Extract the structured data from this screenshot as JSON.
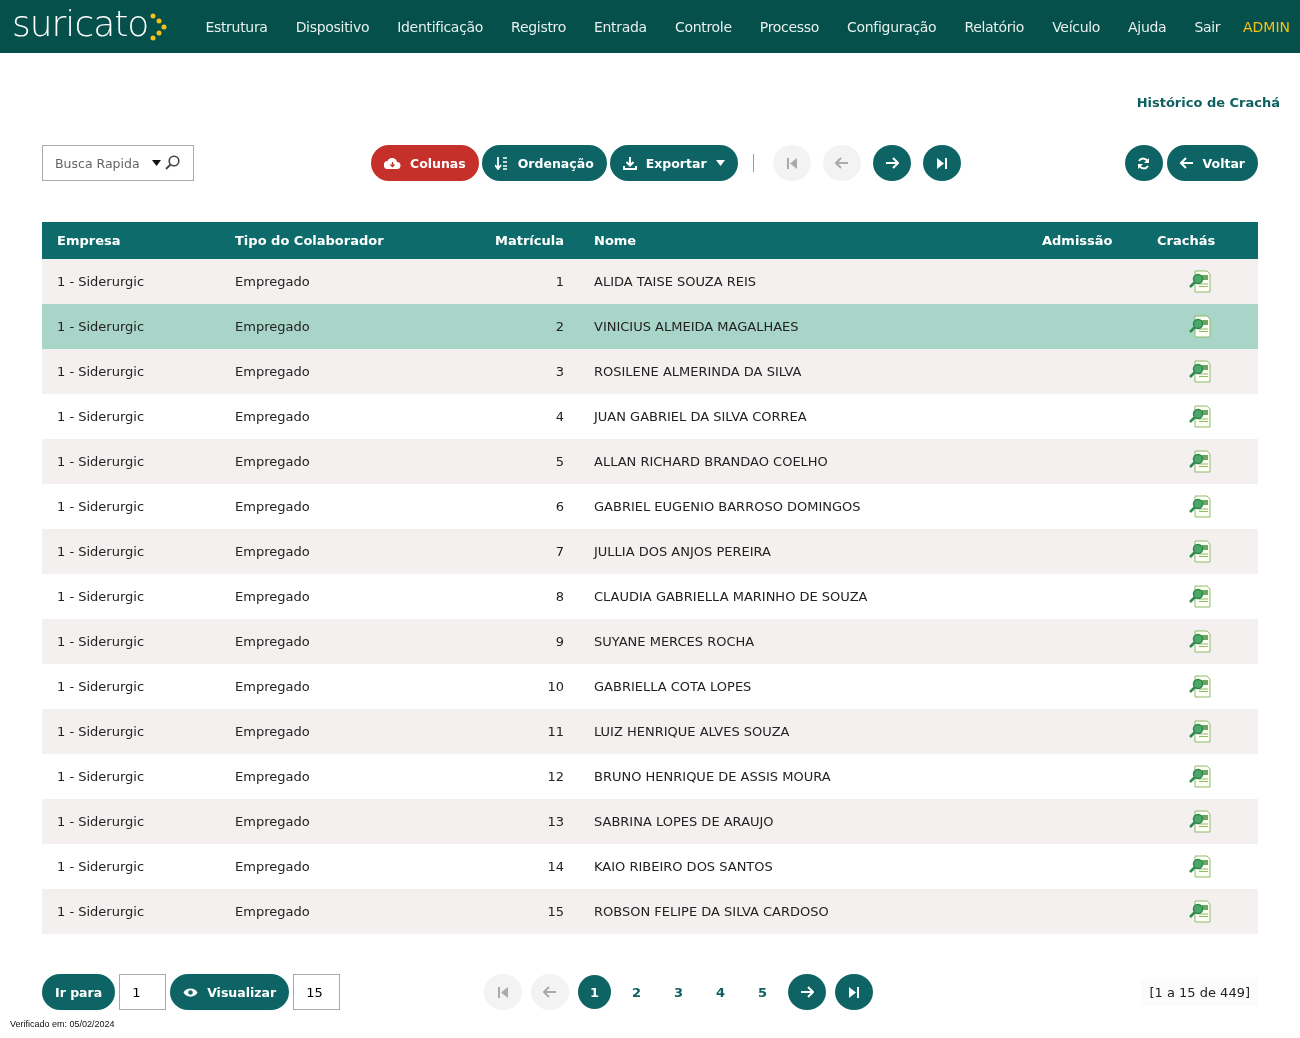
{
  "nav": {
    "logo": "suricato",
    "items": [
      "Estrutura",
      "Dispositivo",
      "Identificação",
      "Registro",
      "Entrada",
      "Controle",
      "Processo",
      "Configuração",
      "Relatório",
      "Veículo",
      "Ajuda",
      "Sair"
    ],
    "user": "ADMIN"
  },
  "page_title": "Histórico de Crachá",
  "toolbar": {
    "search": {
      "placeholder": "Busca Rapida"
    },
    "actions": [
      {
        "kind": "columns",
        "label": "Colunas"
      },
      {
        "kind": "sort",
        "label": "Ordenação"
      },
      {
        "kind": "export",
        "label": "Exportar"
      }
    ],
    "pager": [
      {
        "kind": "first",
        "disabled": true
      },
      {
        "kind": "prev",
        "disabled": true
      },
      {
        "kind": "next",
        "disabled": false
      },
      {
        "kind": "last",
        "disabled": false
      }
    ],
    "back": "Voltar"
  },
  "table": {
    "columns": [
      "Empresa",
      "Tipo do Colaborador",
      "Matrícula",
      "Nome",
      "Admissão",
      "Crachás"
    ],
    "rows": [
      {
        "empresa": "1 - Siderurgic",
        "tipo": "Empregado",
        "matricula": "1",
        "nome": "ALIDA TAISE SOUZA REIS",
        "selected": false
      },
      {
        "empresa": "1 - Siderurgic",
        "tipo": "Empregado",
        "matricula": "2",
        "nome": "VINICIUS ALMEIDA MAGALHAES",
        "selected": true
      },
      {
        "empresa": "1 - Siderurgic",
        "tipo": "Empregado",
        "matricula": "3",
        "nome": "ROSILENE ALMERINDA DA SILVA",
        "selected": false
      },
      {
        "empresa": "1 - Siderurgic",
        "tipo": "Empregado",
        "matricula": "4",
        "nome": "JUAN GABRIEL DA SILVA CORREA",
        "selected": false
      },
      {
        "empresa": "1 - Siderurgic",
        "tipo": "Empregado",
        "matricula": "5",
        "nome": "ALLAN RICHARD BRANDAO COELHO",
        "selected": false
      },
      {
        "empresa": "1 - Siderurgic",
        "tipo": "Empregado",
        "matricula": "6",
        "nome": "GABRIEL EUGENIO BARROSO DOMINGOS",
        "selected": false
      },
      {
        "empresa": "1 - Siderurgic",
        "tipo": "Empregado",
        "matricula": "7",
        "nome": "JULLIA DOS ANJOS PEREIRA",
        "selected": false
      },
      {
        "empresa": "1 - Siderurgic",
        "tipo": "Empregado",
        "matricula": "8",
        "nome": "CLAUDIA GABRIELLA MARINHO DE SOUZA",
        "selected": false
      },
      {
        "empresa": "1 - Siderurgic",
        "tipo": "Empregado",
        "matricula": "9",
        "nome": "SUYANE MERCES ROCHA",
        "selected": false
      },
      {
        "empresa": "1 - Siderurgic",
        "tipo": "Empregado",
        "matricula": "10",
        "nome": "GABRIELLA COTA LOPES",
        "selected": false
      },
      {
        "empresa": "1 - Siderurgic",
        "tipo": "Empregado",
        "matricula": "11",
        "nome": "LUIZ HENRIQUE ALVES SOUZA",
        "selected": false
      },
      {
        "empresa": "1 - Siderurgic",
        "tipo": "Empregado",
        "matricula": "12",
        "nome": "BRUNO HENRIQUE DE ASSIS MOURA",
        "selected": false
      },
      {
        "empresa": "1 - Siderurgic",
        "tipo": "Empregado",
        "matricula": "13",
        "nome": "SABRINA LOPES DE ARAUJO",
        "selected": false
      },
      {
        "empresa": "1 - Siderurgic",
        "tipo": "Empregado",
        "matricula": "14",
        "nome": "KAIO RIBEIRO DOS SANTOS",
        "selected": false
      },
      {
        "empresa": "1 - Siderurgic",
        "tipo": "Empregado",
        "matricula": "15",
        "nome": "ROBSON FELIPE DA SILVA CARDOSO",
        "selected": false
      }
    ]
  },
  "footer": {
    "goto": {
      "label": "Ir para",
      "value": "1"
    },
    "view": {
      "label": "Visualizar",
      "value": "15"
    },
    "pager": [
      {
        "kind": "first",
        "disabled": true
      },
      {
        "kind": "prev",
        "disabled": true
      },
      {
        "kind": "next",
        "disabled": false
      },
      {
        "kind": "last",
        "disabled": false
      }
    ],
    "pages": [
      {
        "label": "1",
        "selected": true
      },
      {
        "label": "2",
        "selected": false
      },
      {
        "label": "3",
        "selected": false
      },
      {
        "label": "4",
        "selected": false
      },
      {
        "label": "5",
        "selected": false
      }
    ],
    "summary": "[1 a 15 de 449]"
  },
  "verified": "Verificado em: 05/02/2024"
}
